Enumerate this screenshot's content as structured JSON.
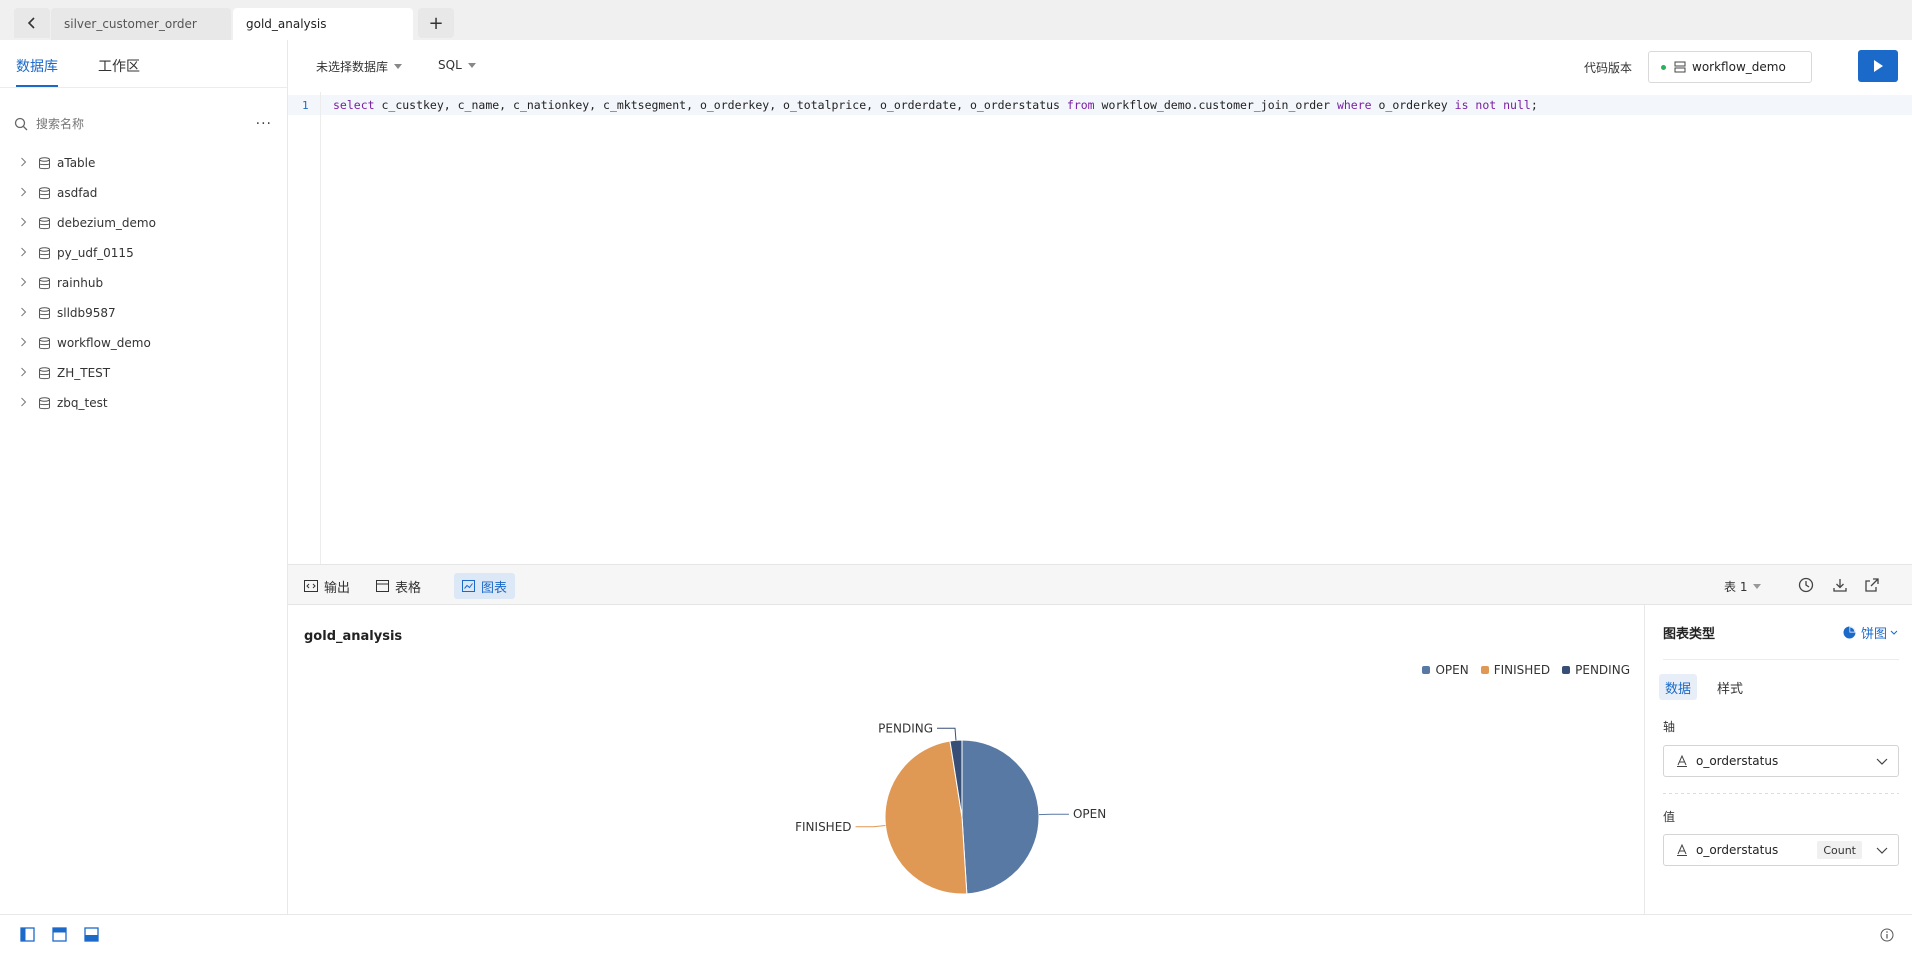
{
  "tabs": {
    "items": [
      {
        "label": "silver_customer_order",
        "active": false
      },
      {
        "label": "gold_analysis",
        "active": true
      }
    ],
    "add_label": "+"
  },
  "sidebar": {
    "tabs": [
      {
        "label": "数据库",
        "active": true
      },
      {
        "label": "工作区",
        "active": false
      }
    ],
    "search_placeholder": "搜索名称",
    "more_label": "···",
    "databases": [
      {
        "label": "aTable"
      },
      {
        "label": "asdfad"
      },
      {
        "label": "debezium_demo"
      },
      {
        "label": "py_udf_0115"
      },
      {
        "label": "rainhub"
      },
      {
        "label": "slldb9587"
      },
      {
        "label": "workflow_demo"
      },
      {
        "label": "ZH_TEST"
      },
      {
        "label": "zbq_test"
      }
    ]
  },
  "editor_header": {
    "database_select": "未选择数据库",
    "language_select": "SQL",
    "version_label": "代码版本",
    "workspace": "workflow_demo"
  },
  "editor": {
    "line_number": "1",
    "code_tokens": [
      {
        "t": "select",
        "kw": true
      },
      {
        "t": " c_custkey, c_name, c_nationkey, c_mktsegment, o_orderkey, o_totalprice, o_orderdate, o_orderstatus ",
        "kw": false
      },
      {
        "t": "from",
        "kw": true
      },
      {
        "t": " workflow_demo.customer_join_order ",
        "kw": false
      },
      {
        "t": "where",
        "kw": true
      },
      {
        "t": " o_orderkey ",
        "kw": false
      },
      {
        "t": "is not null",
        "kw": true
      },
      {
        "t": ";",
        "kw": false
      }
    ]
  },
  "result_bar": {
    "tabs": [
      {
        "label": "输出",
        "active": false
      },
      {
        "label": "表格",
        "active": false
      },
      {
        "label": "图表",
        "active": true
      }
    ],
    "sheet_select": "表 1"
  },
  "chart_panel": {
    "title": "gold_analysis"
  },
  "chart_data": {
    "type": "pie",
    "title": "gold_analysis",
    "legend_position": "top-right",
    "categories": [
      "OPEN",
      "FINISHED",
      "PENDING"
    ],
    "values": [
      49,
      48.5,
      2.5
    ],
    "colors": [
      "#5879a3",
      "#e09955",
      "#374f77"
    ]
  },
  "right_panel": {
    "title": "图表类型",
    "chart_type": "饼图",
    "tabs": [
      {
        "label": "数据",
        "active": true
      },
      {
        "label": "样式",
        "active": false
      }
    ],
    "axis_label": "轴",
    "axis_field": "o_orderstatus",
    "value_label": "值",
    "value_field": "o_orderstatus",
    "value_agg": "Count"
  },
  "colors": {
    "accent": "#1b6ac9"
  }
}
